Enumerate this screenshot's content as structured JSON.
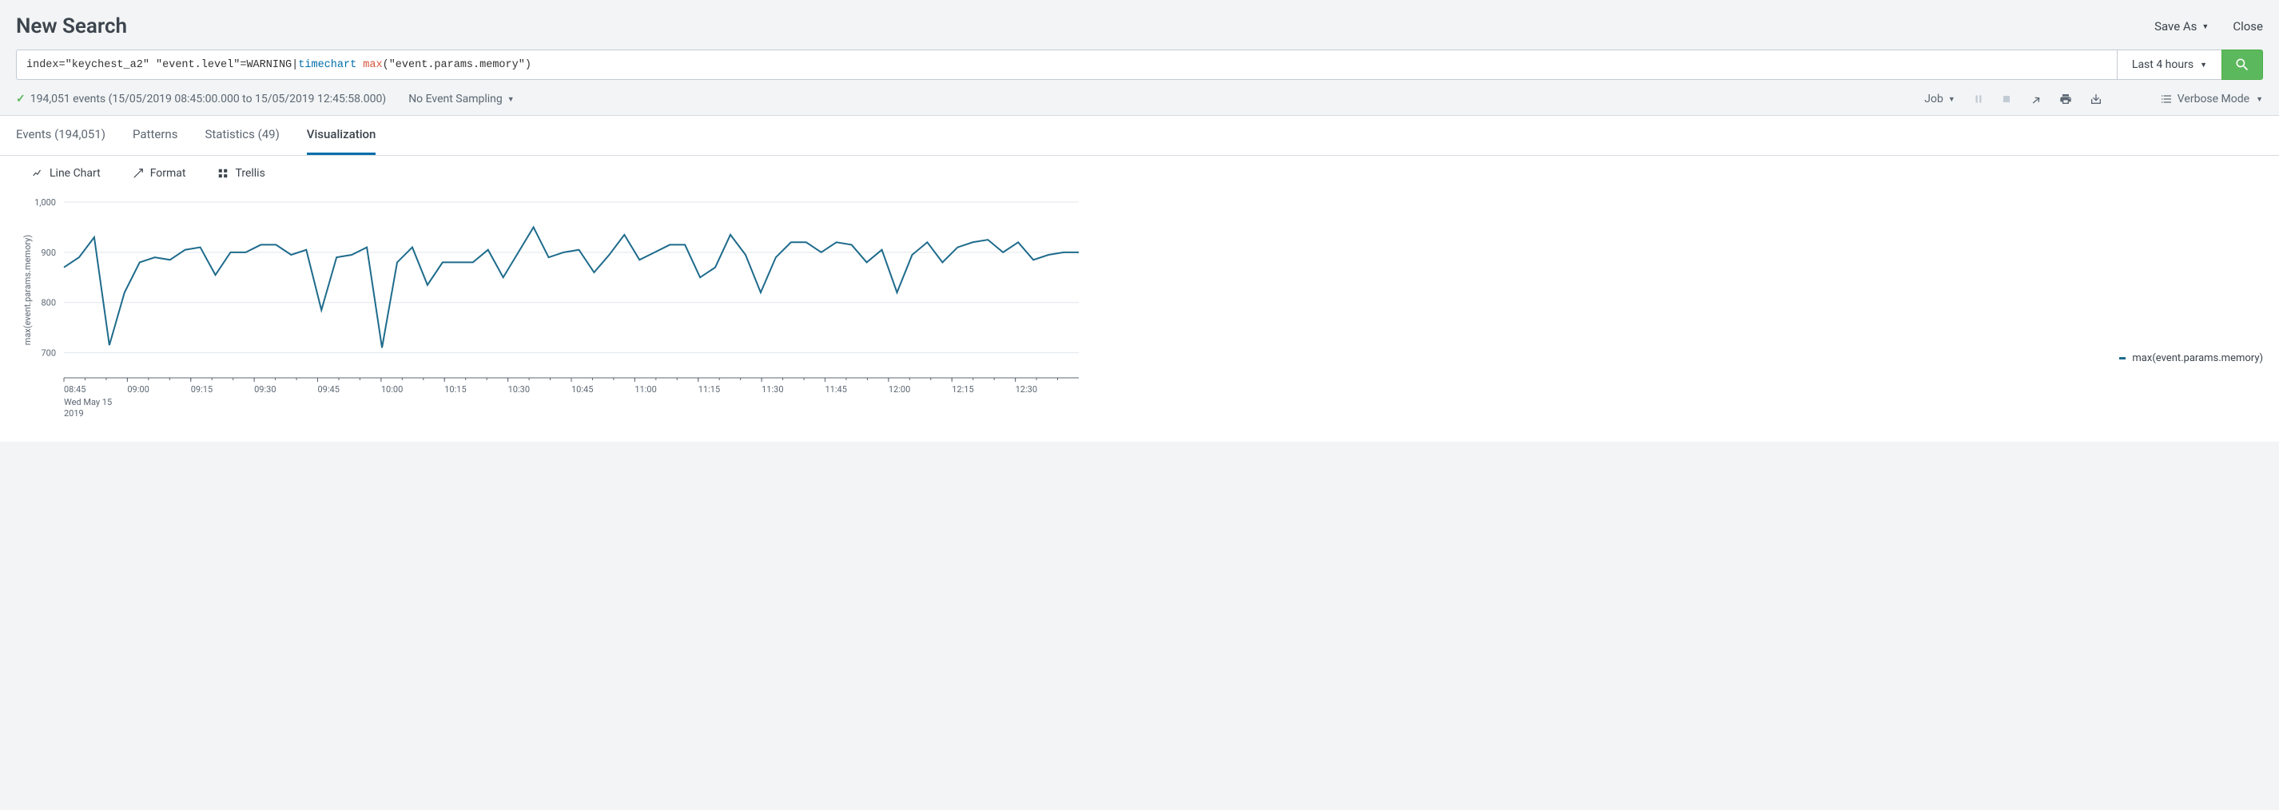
{
  "header": {
    "title": "New Search",
    "save_as": "Save As",
    "close": "Close"
  },
  "search": {
    "query_prefix": "index=\"keychest_a2\" \"event.level\"=WARNING| ",
    "query_cmd": "timechart",
    "query_func": "max",
    "query_args": "(\"event.params.memory\")",
    "time_range": "Last 4 hours"
  },
  "status": {
    "events_text": "194,051 events (15/05/2019 08:45:00.000 to 15/05/2019 12:45:58.000)",
    "sampling": "No Event Sampling",
    "job": "Job",
    "mode": "Verbose Mode"
  },
  "tabs": {
    "events": "Events (194,051)",
    "patterns": "Patterns",
    "statistics": "Statistics (49)",
    "visualization": "Visualization"
  },
  "viz_toolbar": {
    "chart_type": "Line Chart",
    "format": "Format",
    "trellis": "Trellis"
  },
  "legend": {
    "series": "max(event.params.memory)"
  },
  "axes": {
    "y_title": "max(event.params.memory)",
    "x_date": "Wed May 15",
    "x_year": "2019"
  },
  "chart_data": {
    "type": "line",
    "title": "",
    "xlabel": "",
    "ylabel": "max(event.params.memory)",
    "ylim": [
      650,
      1000
    ],
    "x_ticks": [
      "08:45",
      "09:00",
      "09:15",
      "09:30",
      "09:45",
      "10:00",
      "10:15",
      "10:30",
      "10:45",
      "11:00",
      "11:15",
      "11:30",
      "11:45",
      "12:00",
      "12:15",
      "12:30"
    ],
    "y_ticks": [
      700,
      800,
      900,
      1000
    ],
    "series": [
      {
        "name": "max(event.params.memory)",
        "values": [
          870,
          890,
          930,
          715,
          820,
          880,
          890,
          885,
          905,
          910,
          855,
          900,
          900,
          915,
          915,
          895,
          905,
          785,
          890,
          895,
          910,
          710,
          880,
          910,
          835,
          880,
          880,
          880,
          905,
          850,
          900,
          950,
          890,
          900,
          905,
          860,
          895,
          935,
          885,
          900,
          915,
          915,
          850,
          870,
          935,
          895,
          820,
          890,
          920,
          920,
          900,
          920,
          915,
          880,
          905,
          820,
          895,
          920,
          880,
          910,
          920,
          925,
          900,
          920,
          885,
          895,
          900,
          900
        ]
      }
    ]
  }
}
